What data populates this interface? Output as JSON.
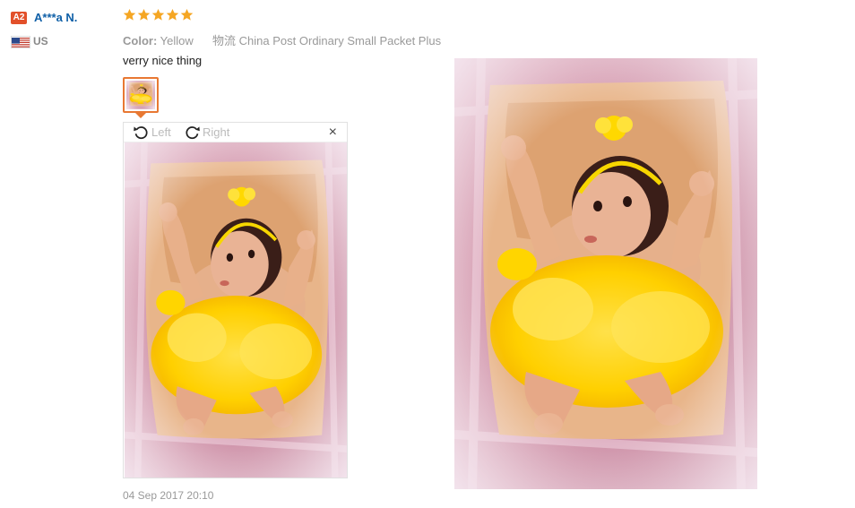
{
  "user": {
    "level": "A2",
    "name": "A***a N.",
    "country": "US"
  },
  "review": {
    "rating": 5,
    "color_label": "Color:",
    "color_value": "Yellow",
    "shipping_label": "物流",
    "shipping_value": "China Post Ordinary Small Packet Plus",
    "comment": "verry nice thing",
    "date": "04 Sep 2017 20:10"
  },
  "viewer": {
    "rotate_left": "Left",
    "rotate_right": "Right",
    "close": "×"
  },
  "colors": {
    "star": "#f5a623",
    "accent": "#e87832",
    "username": "#0e5fa7",
    "badge": "#e2502a"
  }
}
